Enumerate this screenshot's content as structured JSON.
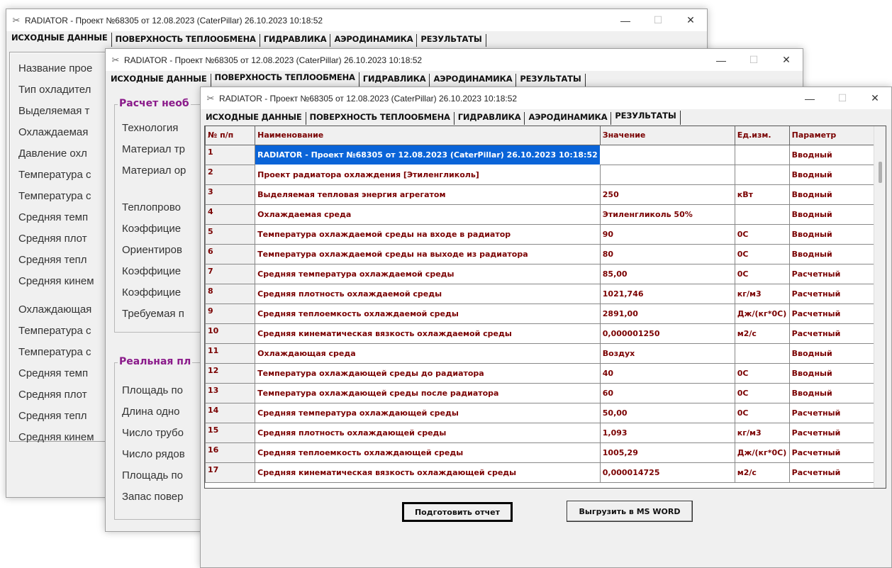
{
  "window_title": "RADIATOR - Проект №68305 от 12.08.2023 (CaterPillar) 26.10.2023 10:18:52",
  "tabs": [
    "ИСХОДНЫЕ ДАННЫЕ",
    "ПОВЕРХНОСТЬ ТЕПЛООБМЕНА",
    "ГИДРАВЛИКА",
    "АЭРОДИНАМИКА",
    "РЕЗУЛЬТАТЫ"
  ],
  "controls": {
    "minimize": "—",
    "maximize": "☐",
    "close": "✕"
  },
  "win1": {
    "labels": [
      "Название прое",
      "Тип охладител",
      "Выделяемая т",
      "Охлаждаемая",
      "Давление охл",
      "Температура с",
      "Температура с",
      "Средняя темп",
      "Средняя плот",
      "Средняя тепл",
      "Средняя кинем",
      "Охлаждающая",
      "Температура с",
      "Температура с",
      "Средняя темп",
      "Средняя плот",
      "Средняя тепл",
      "Средняя кинем"
    ]
  },
  "win2": {
    "group1_title": "Расчет необ",
    "group1_labels": [
      "Технология",
      "Материал тр",
      "Материал ор",
      "Теплопрово",
      "Коэффицие",
      "Ориентиров",
      "Коэффицие",
      "Коэффицие",
      "Требуемая п"
    ],
    "group2_title": "Реальная пл",
    "group2_labels": [
      "Площадь по",
      "Длина одно",
      "Число трубо",
      "Число рядов",
      "Площадь по",
      "Запас повер"
    ]
  },
  "grid": {
    "headers": [
      "№ п/п",
      "Наименование",
      "Значение",
      "Ед.изм.",
      "Параметр"
    ],
    "rows": [
      [
        "1",
        "RADIATOR - Проект №68305 от 12.08.2023 (CaterPillar) 26.10.2023 10:18:52",
        "",
        "",
        "Вводный"
      ],
      [
        "2",
        "Проект радиатора охлаждения [Этиленгликоль]",
        "",
        "",
        "Вводный"
      ],
      [
        "3",
        "Выделяемая тепловая энергия агрегатом",
        "250",
        "кВт",
        "Вводный"
      ],
      [
        "4",
        "Охлаждаемая среда",
        "Этиленгликоль 50%",
        "",
        "Вводный"
      ],
      [
        "5",
        "Температура охлаждаемой среды на входе в радиатор",
        "90",
        "0С",
        "Вводный"
      ],
      [
        "6",
        "Температура охлаждаемой среды на выходе из радиатора",
        "80",
        "0С",
        "Вводный"
      ],
      [
        "7",
        "Средняя температура охлаждаемой среды",
        "85,00",
        "0С",
        "Расчетный"
      ],
      [
        "8",
        "Средняя плотность охлаждаемой среды",
        "1021,746",
        "кг/м3",
        "Расчетный"
      ],
      [
        "9",
        "Средняя теплоемкость охлаждаемой среды",
        "2891,00",
        "Дж/(кг*0С)",
        "Расчетный"
      ],
      [
        "10",
        "Средняя кинематическая вязкость охлаждаемой среды",
        "0,000001250",
        "м2/с",
        "Расчетный"
      ],
      [
        "11",
        "Охлаждающая среда",
        "Воздух",
        "",
        "Вводный"
      ],
      [
        "12",
        "Температура охлаждающей среды до радиатора",
        "40",
        "0С",
        "Вводный"
      ],
      [
        "13",
        "Температура охлаждающей среды после радиатора",
        "60",
        "0С",
        "Вводный"
      ],
      [
        "14",
        "Средняя температура охлаждающей среды",
        "50,00",
        "0С",
        "Расчетный"
      ],
      [
        "15",
        "Средняя плотность охлаждающей среды",
        "1,093",
        "кг/м3",
        "Расчетный"
      ],
      [
        "16",
        "Средняя теплоемкость охлаждающей среды",
        "1005,29",
        "Дж/(кг*0С)",
        "Расчетный"
      ],
      [
        "17",
        "Средняя кинематическая вязкость охлаждающей среды",
        "0,000014725",
        "м2/с",
        "Расчетный"
      ]
    ]
  },
  "buttons": {
    "report": "Подготовить отчет",
    "export": "Выгрузить в MS WORD"
  }
}
